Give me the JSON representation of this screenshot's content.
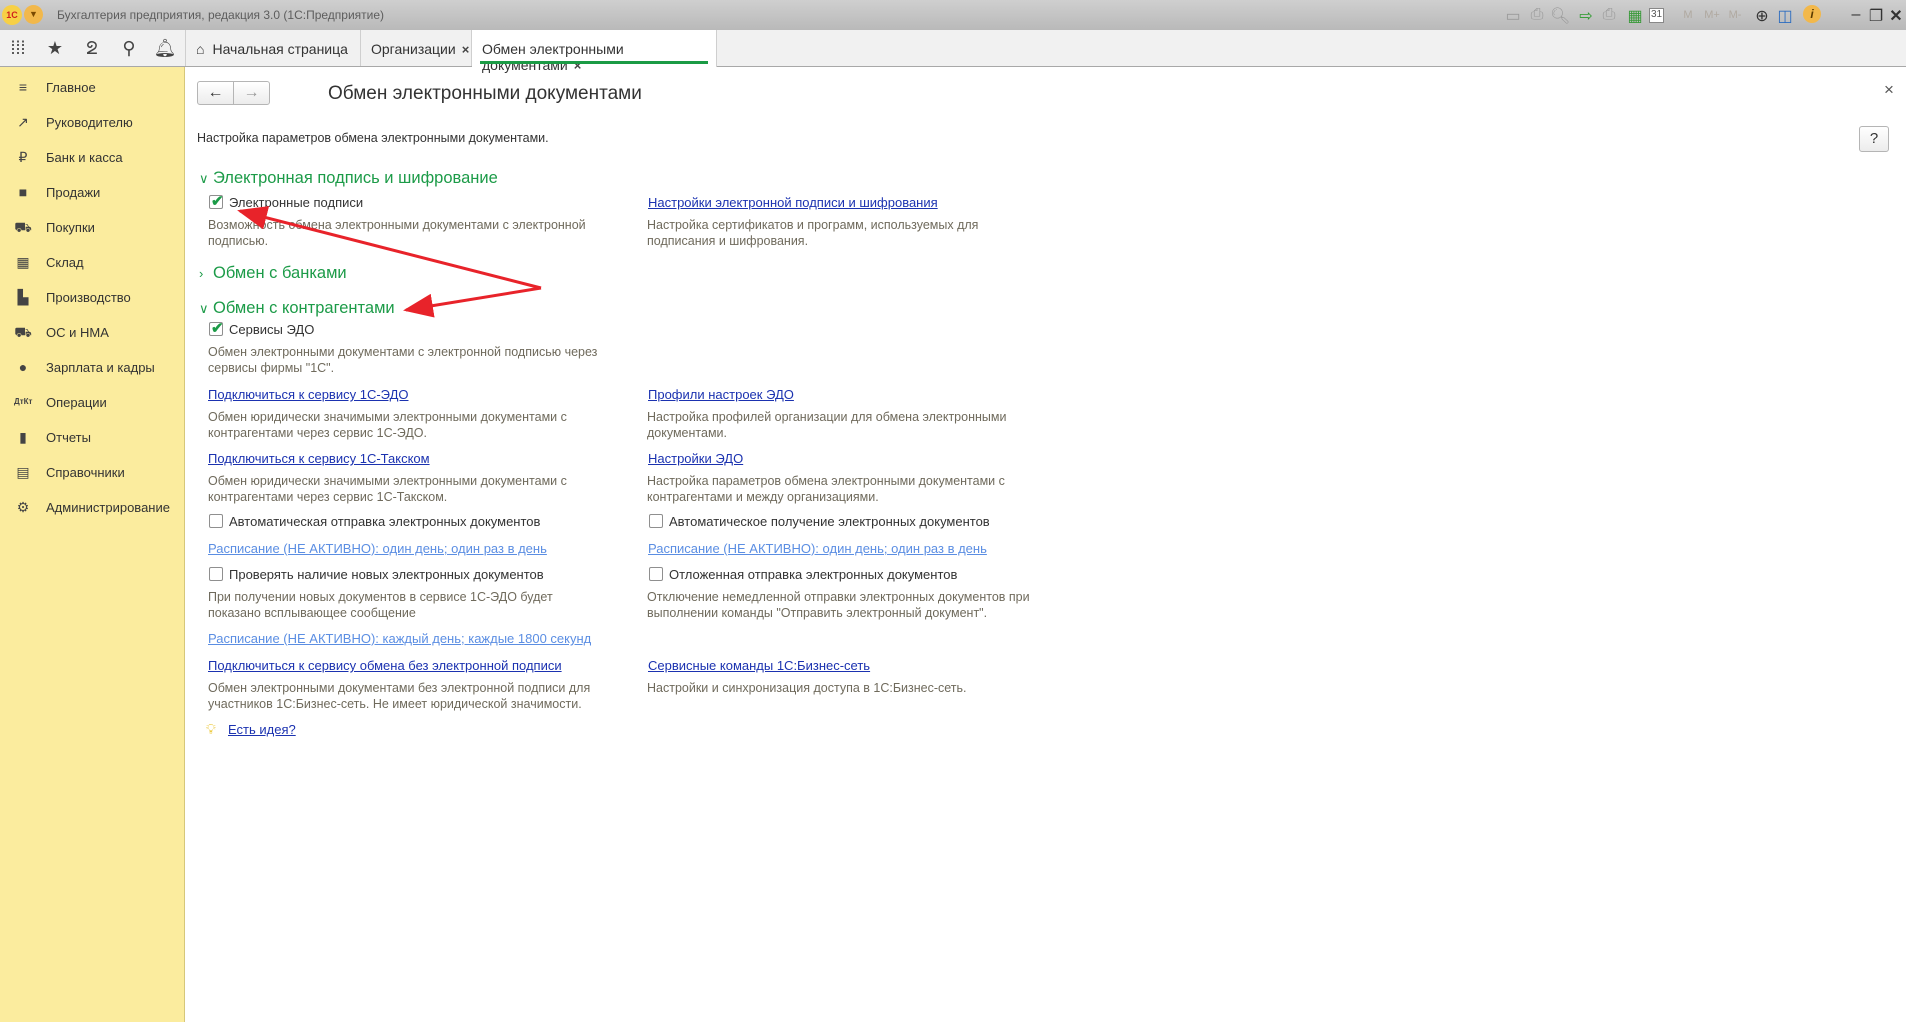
{
  "window": {
    "title": "Бухгалтерия предприятия, редакция 3.0  (1С:Предприятие)",
    "logo": "1С"
  },
  "toolbar_icons": [
    "save-icon",
    "print-icon",
    "preview-icon",
    "link-icon",
    "print-link-icon",
    "calculator-icon",
    "calendar-icon",
    "memory-m-icon",
    "memory-plus-icon",
    "memory-minus-icon",
    "zoom-icon",
    "panels-icon",
    "info-icon",
    "minimize-icon",
    "restore-icon",
    "close-icon"
  ],
  "toolbar_labels": {
    "m": "M",
    "mplus": "M+",
    "mminus": "M-",
    "cal": "31"
  },
  "tabs": [
    {
      "label": "Начальная страница"
    },
    {
      "label": "Организации",
      "close": "×"
    },
    {
      "label": "Обмен электронными документами",
      "close": "×"
    }
  ],
  "sidebar": {
    "items": [
      {
        "label": "Главное",
        "icon": "menu-icon",
        "glyph": "≡"
      },
      {
        "label": "Руководителю",
        "icon": "trend-icon",
        "glyph": "↗"
      },
      {
        "label": "Банк и касса",
        "icon": "ruble-icon",
        "glyph": "₽"
      },
      {
        "label": "Продажи",
        "icon": "bag-icon",
        "glyph": "■"
      },
      {
        "label": "Покупки",
        "icon": "cart-icon",
        "glyph": "⛟"
      },
      {
        "label": "Склад",
        "icon": "warehouse-icon",
        "glyph": "▦"
      },
      {
        "label": "Производство",
        "icon": "factory-icon",
        "glyph": "▙"
      },
      {
        "label": "ОС и НМА",
        "icon": "truck-icon",
        "glyph": "⛟"
      },
      {
        "label": "Зарплата и кадры",
        "icon": "person-icon",
        "glyph": "●"
      },
      {
        "label": "Операции",
        "icon": "dt-kt-icon",
        "glyph": "ДтКт"
      },
      {
        "label": "Отчеты",
        "icon": "bar-chart-icon",
        "glyph": "▮"
      },
      {
        "label": "Справочники",
        "icon": "books-icon",
        "glyph": "▤"
      },
      {
        "label": "Администрирование",
        "icon": "gear-icon",
        "glyph": "⚙"
      }
    ]
  },
  "page": {
    "title": "Обмен электронными документами",
    "nav_back": "←",
    "nav_forward": "→",
    "close": "×",
    "help": "?",
    "intro": "Настройка параметров обмена электронными документами.",
    "section1": {
      "title": "Электронная подпись и шифрование",
      "checkbox": {
        "label": "Электронные подписи",
        "checked": true
      },
      "desc": "Возможность обмена электронными документами с электронной подписью.",
      "link": "Настройки электронной подписи и шифрования",
      "link_desc": "Настройка сертификатов и программ, используемых для подписания и шифрования."
    },
    "section2": {
      "title": "Обмен с банками"
    },
    "section3": {
      "title": "Обмен с контрагентами",
      "checkbox": {
        "label": "Сервисы ЭДО",
        "checked": true
      },
      "desc": "Обмен электронными документами с электронной подписью через сервисы фирмы \"1С\".",
      "link1": "Подключиться к сервису 1С-ЭДО",
      "link1_desc": "Обмен юридически значимыми электронными документами с контрагентами через сервис 1С-ЭДО.",
      "link2": "Профили настроек ЭДО",
      "link2_desc": "Настройка профилей организации для обмена электронными документами.",
      "link3": "Подключиться к сервису 1С-Такском",
      "link3_desc": "Обмен юридически значимыми электронными документами с контрагентами через сервис 1С-Такском.",
      "link4": "Настройки ЭДО",
      "link4_desc": "Настройка параметров обмена электронными документами с контрагентами и между организациями.",
      "auto_send": {
        "label": "Автоматическая отправка электронных документов",
        "checked": false
      },
      "auto_send_schedule": "Расписание (НЕ АКТИВНО): один день; один раз в день",
      "auto_receive": {
        "label": "Автоматическое получение электронных документов",
        "checked": false
      },
      "auto_receive_schedule": "Расписание (НЕ АКТИВНО): один день; один раз в день",
      "check_new": {
        "label": "Проверять наличие новых электронных документов",
        "checked": false
      },
      "check_new_desc": "При получении новых документов в сервисе 1С-ЭДО будет показано всплывающее сообщение",
      "check_new_schedule": "Расписание (НЕ АКТИВНО): каждый день; каждые 1800 секунд",
      "deferred": {
        "label": "Отложенная отправка электронных документов",
        "checked": false
      },
      "deferred_desc": "Отключение немедленной отправки электронных документов при выполнении команды \"Отправить электронный документ\".",
      "link5": "Подключиться к сервису обмена без электронной подписи",
      "link5_desc": "Обмен электронными документами без электронной подписи для участников 1С:Бизнес-сеть. Не имеет юридической значимости.",
      "link6": "Сервисные команды 1С:Бизнес-сеть",
      "link6_desc": "Настройки и синхронизация доступа в 1С:Бизнес-сеть."
    },
    "idea_link": "Есть идея?"
  },
  "colors": {
    "accent": "#1c9b48",
    "sidebar": "#fbec9e",
    "link": "#1b32b0",
    "annotation": "#e8232a"
  }
}
